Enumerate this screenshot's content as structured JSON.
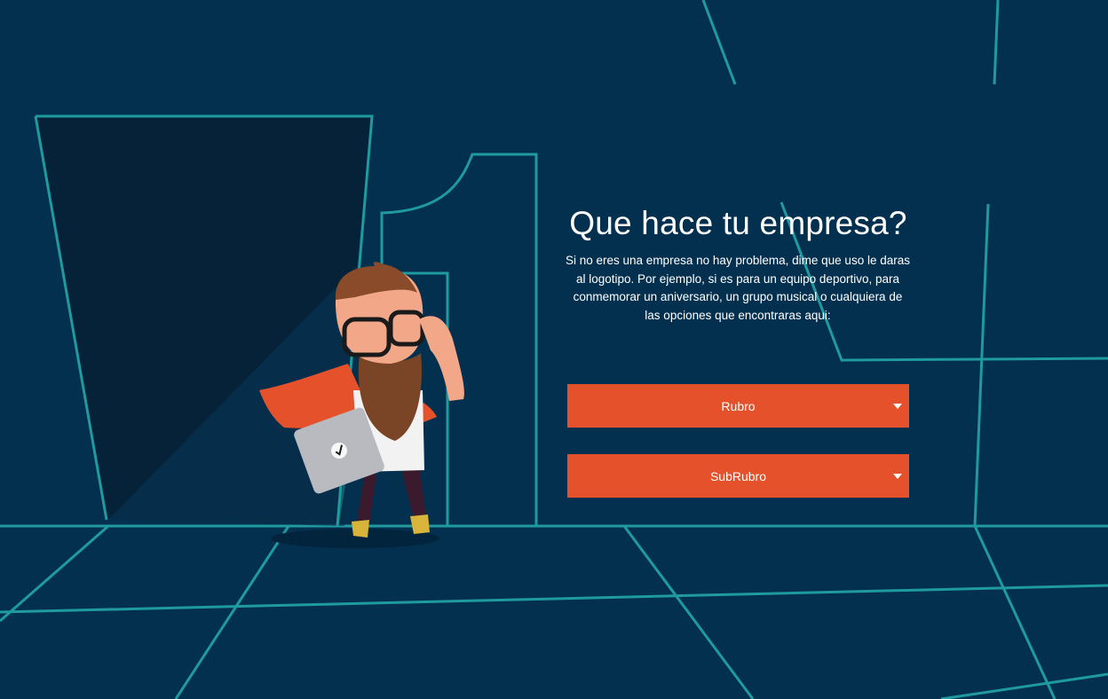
{
  "heading": "Que hace tu empresa?",
  "description": "Si no eres una empresa no hay problema, dime que uso le daras al logotipo. Por ejemplo, si es para un equipo deportivo, para conmemorar un aniversario, un grupo musical o cualquiera de las opciones que encontraras aqui:",
  "selects": {
    "rubro": {
      "label": "Rubro",
      "icon": "chevron-down-icon"
    },
    "subrubro": {
      "label": "SubRubro",
      "icon": "chevron-down-icon"
    }
  },
  "colors": {
    "background": "#04304f",
    "line": "#1f9a9e",
    "accent": "#e4512a",
    "text": "#ffffff"
  }
}
